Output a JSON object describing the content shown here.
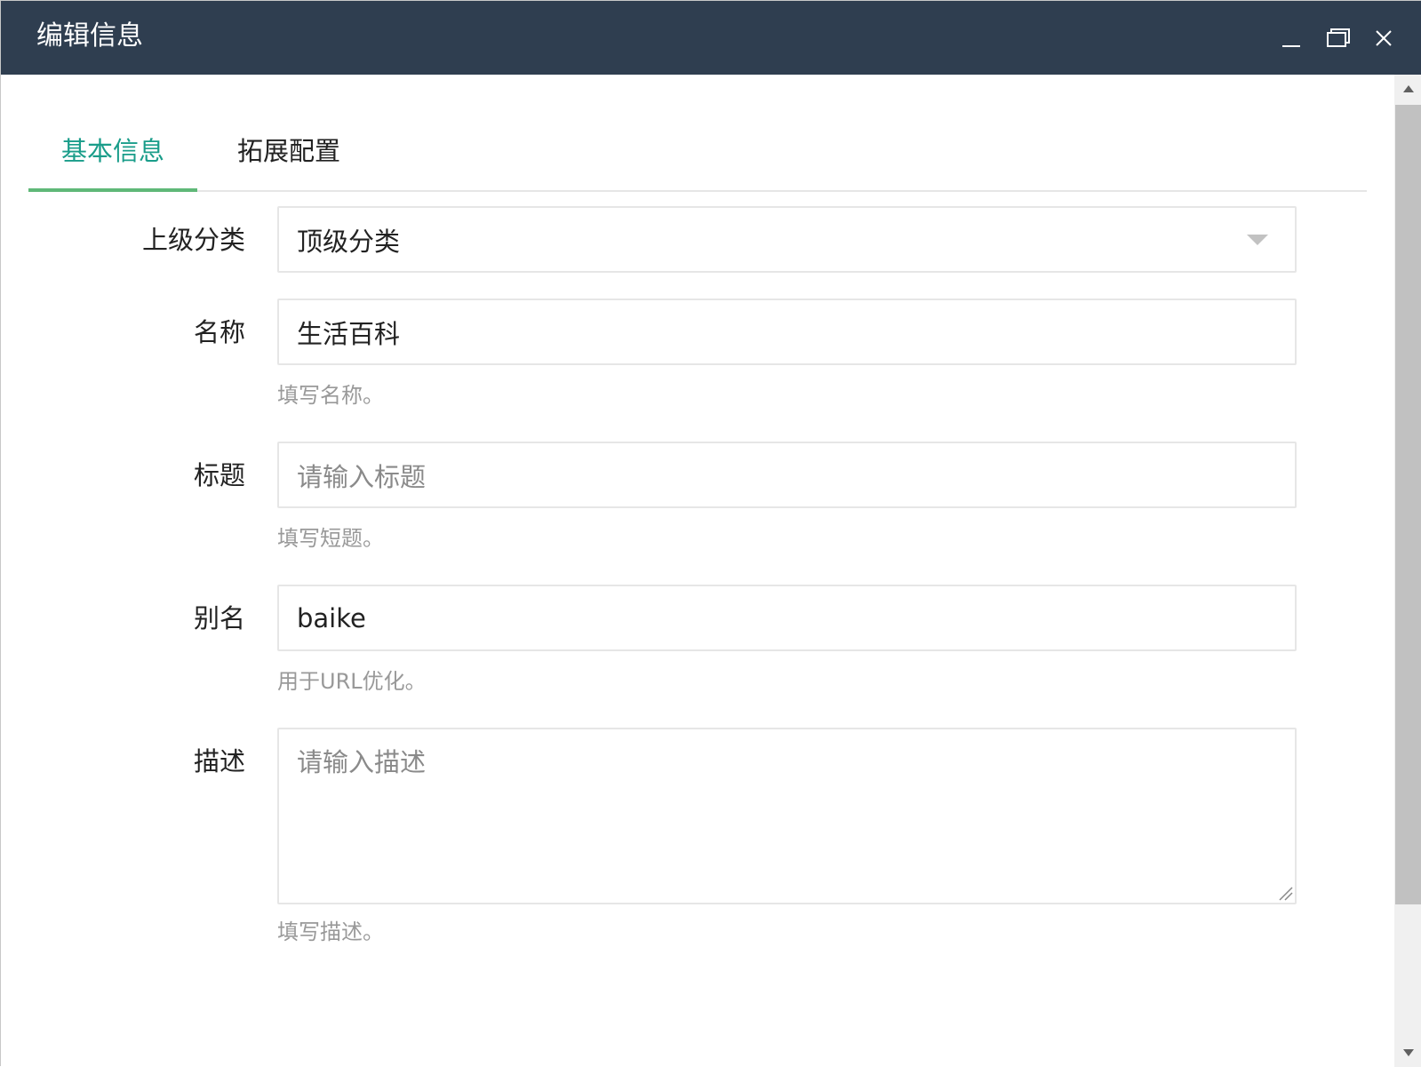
{
  "window": {
    "title": "编辑信息"
  },
  "tabs": [
    {
      "label": "基本信息",
      "active": true
    },
    {
      "label": "拓展配置",
      "active": false
    }
  ],
  "form": {
    "parent_category": {
      "label": "上级分类",
      "value": "顶级分类"
    },
    "name": {
      "label": "名称",
      "value": "生活百科",
      "hint": "填写名称。"
    },
    "title": {
      "label": "标题",
      "placeholder": "请输入标题",
      "hint": "填写短题。"
    },
    "alias": {
      "label": "别名",
      "value": "baike",
      "hint": "用于URL优化。"
    },
    "description": {
      "label": "描述",
      "placeholder": "请输入描述",
      "hint": "填写描述。"
    }
  },
  "colors": {
    "titlebar_bg": "#2f3e50",
    "active_tab_text": "#1a9d8a",
    "active_tab_underline": "#5fb878",
    "hint_text": "#999999"
  }
}
